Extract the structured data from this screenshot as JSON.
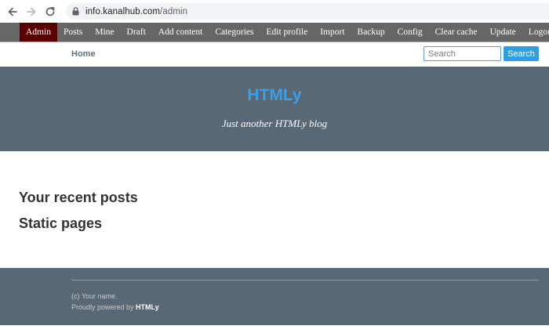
{
  "browser": {
    "url_host": "info.kanalhub.com",
    "url_path": "/admin",
    "icons": [
      "back-arrow",
      "forward-arrow",
      "reload",
      "lock"
    ]
  },
  "admin_bar": {
    "items": [
      {
        "label": "Admin",
        "active": true
      },
      {
        "label": "Posts"
      },
      {
        "label": "Mine"
      },
      {
        "label": "Draft"
      },
      {
        "label": "Add content"
      },
      {
        "label": "Categories"
      },
      {
        "label": "Edit profile"
      },
      {
        "label": "Import"
      },
      {
        "label": "Backup"
      },
      {
        "label": "Config"
      },
      {
        "label": "Clear cache"
      },
      {
        "label": "Update"
      },
      {
        "label": "Logout"
      }
    ]
  },
  "nav": {
    "home_label": "Home",
    "search_placeholder": "Search",
    "search_button": "Search"
  },
  "header": {
    "title": "HTMLy",
    "tagline": "Just another HTMLy blog"
  },
  "main": {
    "recent_posts_heading": "Your recent posts",
    "static_pages_heading": "Static pages"
  },
  "footer": {
    "copyright": "(c) Your name.",
    "powered_prefix": "Proudly powered by ",
    "powered_name": "HTMLy"
  },
  "colors": {
    "admin_bar_bg": "#666666",
    "admin_active_bg": "#5a0000",
    "header_bg": "#586875",
    "title_blue": "#3a9fe8",
    "search_button_bg": "#2e9fe0"
  }
}
